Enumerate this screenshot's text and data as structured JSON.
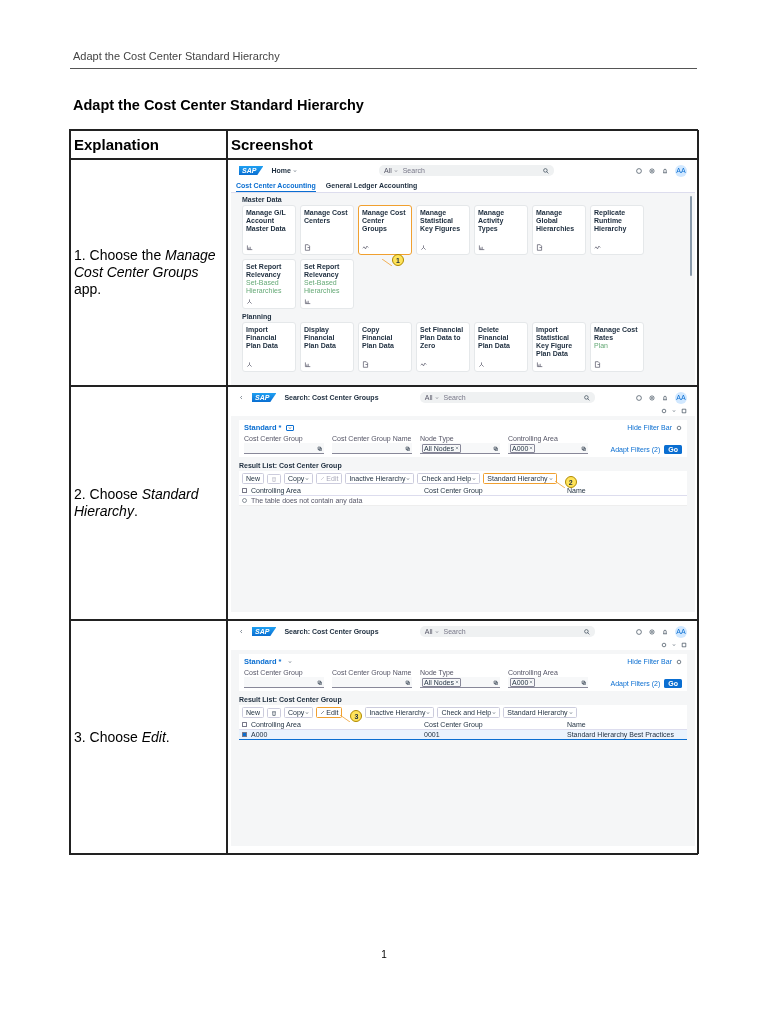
{
  "page_header": "Adapt the Cost Center Standard Hierarchy",
  "title": "Adapt the Cost Center Standard Hierarchy",
  "table": {
    "columns": [
      "Explanation",
      "Screenshot"
    ],
    "rows": [
      {
        "step": "1. Choose the *Manage Cost Center Groups* app.",
        "screenshot": {
          "kind": "launchpad",
          "logo": "SAP",
          "title": "Home",
          "scope": "All",
          "search_placeholder": "Search",
          "avatar": "AA",
          "tabs": [
            {
              "label": "Cost Center Accounting",
              "selected": true
            },
            {
              "label": "General Ledger Accounting",
              "selected": false
            }
          ],
          "sections": [
            {
              "heading": "Master Data",
              "tiles": [
                {
                  "title": "Manage G/L Account Master Data",
                  "highlighted": false
                },
                {
                  "title": "Manage Cost Centers",
                  "highlighted": false
                },
                {
                  "title": "Manage Cost Center Groups",
                  "highlighted": true,
                  "callout": "1"
                },
                {
                  "title": "Manage Statistical Key Figures",
                  "highlighted": false
                },
                {
                  "title": "Manage Activity Types",
                  "highlighted": false
                },
                {
                  "title": "Manage Global Hierarchies",
                  "highlighted": false
                },
                {
                  "title": "Replicate Runtime Hierarchy",
                  "highlighted": false
                },
                {
                  "title": "Set Report Relevancy",
                  "subtitle": "Set-Based Hierarchies",
                  "highlighted": false
                },
                {
                  "title": "Set Report Relevancy",
                  "subtitle": "Set-Based Hierarchies",
                  "highlighted": false
                }
              ]
            },
            {
              "heading": "Planning",
              "tiles": [
                {
                  "title": "Import Financial Plan Data",
                  "highlighted": false
                },
                {
                  "title": "Display Financial Plan Data",
                  "highlighted": false
                },
                {
                  "title": "Copy Financial Plan Data",
                  "highlighted": false
                },
                {
                  "title": "Set Financial Plan Data to Zero",
                  "highlighted": false
                },
                {
                  "title": "Delete Financial Plan Data",
                  "highlighted": false
                },
                {
                  "title": "Import Statistical Key Figure Plan Data",
                  "highlighted": false
                },
                {
                  "title": "Manage Cost Rates",
                  "subtitle": "Plan",
                  "highlighted": false
                }
              ]
            }
          ]
        }
      },
      {
        "step": "2. Choose *Standard Hierarchy*.",
        "screenshot": {
          "kind": "list_report",
          "logo": "SAP",
          "title": "Search: Cost Center Groups",
          "scope": "All",
          "search_placeholder": "Search",
          "avatar": "AA",
          "variant": "Standard *",
          "variant_button_focused": true,
          "hide_filter_bar": "Hide Filter Bar",
          "filters": [
            {
              "label": "Cost Center Group"
            },
            {
              "label": "Cost Center Group Name"
            },
            {
              "label": "Node Type",
              "token": "All Nodes"
            },
            {
              "label": "Controlling Area",
              "token": "A000"
            }
          ],
          "adapt_filters": "Adapt Filters (2)",
          "go": "Go",
          "result_title": "Result List: Cost Center Group",
          "toolbar": [
            {
              "kind": "text",
              "label": "New",
              "disabled": false,
              "highlighted": false
            },
            {
              "kind": "delete",
              "disabled": true,
              "highlighted": false
            },
            {
              "kind": "menu",
              "label": "Copy",
              "disabled": false,
              "highlighted": false
            },
            {
              "kind": "edit",
              "label": "Edit",
              "disabled": true,
              "highlighted": false
            },
            {
              "kind": "menu",
              "label": "Inactive Hierarchy",
              "disabled": false,
              "highlighted": false
            },
            {
              "kind": "menu",
              "label": "Check and Help",
              "disabled": false,
              "highlighted": false
            },
            {
              "kind": "menu",
              "label": "Standard Hierarchy",
              "disabled": false,
              "highlighted": true,
              "callout": "2"
            }
          ],
          "all_selected": false,
          "columns": [
            "Controlling Area",
            "Cost Center Group",
            "Name"
          ],
          "no_data": "The table does not contain any data"
        }
      },
      {
        "step": "3. Choose *Edit*.",
        "screenshot": {
          "kind": "list_report",
          "logo": "SAP",
          "title": "Search: Cost Center Groups",
          "scope": "All",
          "search_placeholder": "Search",
          "avatar": "AA",
          "variant": "Standard *",
          "variant_button_focused": false,
          "hide_filter_bar": "Hide Filter Bar",
          "filters": [
            {
              "label": "Cost Center Group"
            },
            {
              "label": "Cost Center Group Name"
            },
            {
              "label": "Node Type",
              "token": "All Nodes"
            },
            {
              "label": "Controlling Area",
              "token": "A000"
            }
          ],
          "adapt_filters": "Adapt Filters (2)",
          "go": "Go",
          "result_title": "Result List: Cost Center Group",
          "toolbar": [
            {
              "kind": "text",
              "label": "New",
              "disabled": false,
              "highlighted": false
            },
            {
              "kind": "delete",
              "disabled": false,
              "highlighted": false
            },
            {
              "kind": "menu",
              "label": "Copy",
              "disabled": false,
              "highlighted": false
            },
            {
              "kind": "edit",
              "label": "Edit",
              "disabled": false,
              "highlighted": true,
              "callout": "3"
            },
            {
              "kind": "menu",
              "label": "Inactive Hierarchy",
              "disabled": false,
              "highlighted": false
            },
            {
              "kind": "menu",
              "label": "Check and Help",
              "disabled": false,
              "highlighted": false
            },
            {
              "kind": "menu",
              "label": "Standard Hierarchy",
              "disabled": false,
              "highlighted": false
            }
          ],
          "all_selected": false,
          "columns": [
            "Controlling Area",
            "Cost Center Group",
            "Name"
          ],
          "rows": [
            {
              "cells": [
                "A000",
                "0001",
                "Standard Hierarchy Best Practices"
              ],
              "selected": true
            }
          ]
        }
      }
    ]
  },
  "page_number": "1"
}
